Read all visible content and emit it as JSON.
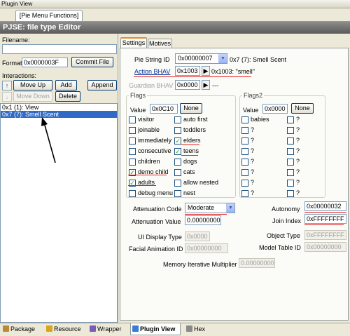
{
  "window": {
    "title": "Plugin View",
    "doc_tab": "[Pie Menu Functions]"
  },
  "editor": {
    "heading": "PJSE: file type Editor"
  },
  "left": {
    "filename_label": "Filename:",
    "filename_value": "",
    "format_label": "Format",
    "format_value": "0x0000003F",
    "commit_file": "Commit File",
    "interactions_label": "Interactions:",
    "move_up": "Move Up",
    "add": "Add",
    "append": "Append",
    "move_down": "Move Down",
    "delete": "Delete",
    "list_items": [
      "0x1 (1): View",
      "0x7 (7): Smell Scent"
    ],
    "selected_index": 1
  },
  "tabs": [
    "Settings",
    "Motives"
  ],
  "settings": {
    "pie_string_id_label": "Pie String ID",
    "pie_string_id_value": "0x00000007",
    "pie_string_text": "0x7 (7): Smell Scent",
    "action_bhav_label": "Action BHAV",
    "action_bhav_value": "0x1003",
    "action_bhav_text": "0x1003: \"smell\"",
    "guardian_bhav_label": "Guardian BHAV",
    "guardian_bhav_value": "0x0000",
    "guardian_bhav_text": "---",
    "flags": {
      "title": "Flags",
      "value_label": "Value",
      "value": "0x0C10",
      "none_button": "None",
      "items": [
        {
          "label": "visitor",
          "checked": false
        },
        {
          "label": "auto first",
          "checked": false
        },
        {
          "label": "joinable",
          "checked": false
        },
        {
          "label": "toddlers",
          "checked": false
        },
        {
          "label": "immediately",
          "checked": false
        },
        {
          "label": "elders",
          "checked": true
        },
        {
          "label": "consecutive",
          "checked": false
        },
        {
          "label": "teens",
          "checked": true
        },
        {
          "label": "children",
          "checked": false
        },
        {
          "label": "dogs",
          "checked": false
        },
        {
          "label": "demo child",
          "checked": true
        },
        {
          "label": "cats",
          "checked": false
        },
        {
          "label": "adults",
          "checked": true
        },
        {
          "label": "allow nested",
          "checked": false
        },
        {
          "label": "debug menu",
          "checked": false
        },
        {
          "label": "nest",
          "checked": false
        }
      ]
    },
    "flags2": {
      "title": "Flags2",
      "value_label": "Value",
      "value": "0x0000",
      "none_button": "None",
      "items": [
        {
          "label": "babies",
          "checked": false
        },
        {
          "label": "?",
          "checked": false
        },
        {
          "label": "?",
          "checked": false
        },
        {
          "label": "?",
          "checked": false
        },
        {
          "label": "?",
          "checked": false
        },
        {
          "label": "?",
          "checked": false
        },
        {
          "label": "?",
          "checked": false
        },
        {
          "label": "?",
          "checked": false
        },
        {
          "label": "?",
          "checked": false
        },
        {
          "label": "?",
          "checked": false
        },
        {
          "label": "?",
          "checked": false
        },
        {
          "label": "?",
          "checked": false
        },
        {
          "label": "?",
          "checked": false
        },
        {
          "label": "?",
          "checked": false
        },
        {
          "label": "?",
          "checked": false
        },
        {
          "label": "?",
          "checked": false
        }
      ]
    },
    "attenuation_code_label": "Attenuation Code",
    "attenuation_code_value": "Moderate",
    "attenuation_value_label": "Attenuation Value",
    "attenuation_value": "0.00000000",
    "autonomy_label": "Autonomy",
    "autonomy_value": "0x00000032",
    "join_index_label": "Join Index",
    "join_index_value": "0xFFFFFFFF",
    "ui_display_type_label": "UI Display Type",
    "ui_display_type_value": "0x0000",
    "object_type_label": "Object Type",
    "object_type_value": "0xFFFFFFFF",
    "facial_animation_label": "Facial Animation ID",
    "facial_animation_value": "0x00000000",
    "model_table_label": "Model Table ID",
    "model_table_value": "0x00000000",
    "memory_label": "Memory Iterative Multiplier",
    "memory_value": "0.00000000"
  },
  "bottom_tabs": [
    {
      "label": "Package",
      "icon": "package-icon",
      "active": false
    },
    {
      "label": "Resource",
      "icon": "resource-icon",
      "active": false
    },
    {
      "label": "Wrapper",
      "icon": "wrapper-icon",
      "active": false
    },
    {
      "label": "Plugin View",
      "icon": "plugin-view-icon",
      "active": true
    },
    {
      "label": "Hex",
      "icon": "hex-icon",
      "active": false
    }
  ],
  "colors": {
    "accent": "#316ac5",
    "annotation_red": "#e02020",
    "check_green": "#21a121"
  }
}
